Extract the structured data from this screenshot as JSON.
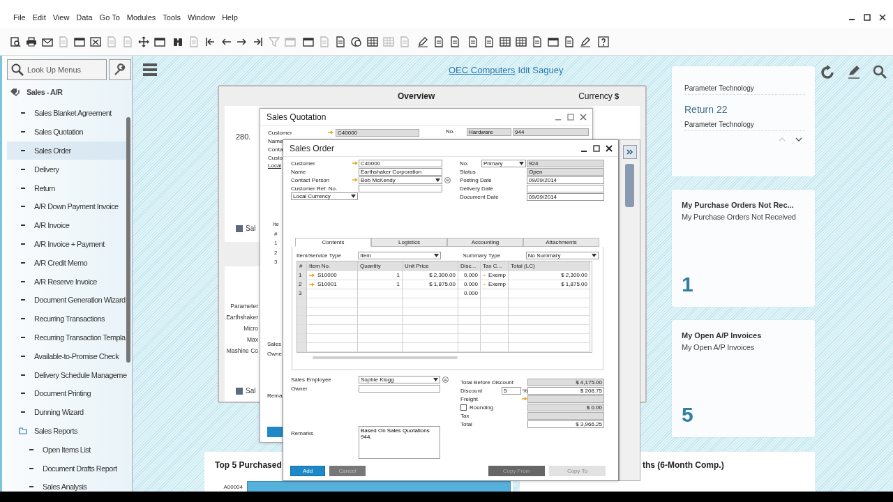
{
  "menu_bar": {
    "items": [
      "File",
      "Edit",
      "View",
      "Data",
      "Go To",
      "Modules",
      "Tools",
      "Window",
      "Help"
    ]
  },
  "toolbar": {
    "groups": [
      [
        {
          "kind": "find",
          "disabled": false
        },
        {
          "kind": "print",
          "disabled": false
        },
        {
          "kind": "email",
          "disabled": false
        },
        {
          "kind": "doc",
          "disabled": true
        },
        {
          "kind": "window",
          "disabled": false
        },
        {
          "kind": "excel",
          "disabled": false
        },
        {
          "kind": "doc",
          "disabled": true
        },
        {
          "kind": "doc",
          "disabled": true
        },
        {
          "kind": "move",
          "disabled": false
        },
        {
          "kind": "window",
          "disabled": false
        }
      ],
      [
        {
          "kind": "binoculars",
          "disabled": false
        },
        {
          "kind": "doc",
          "disabled": true
        },
        {
          "kind": "first",
          "disabled": false
        },
        {
          "kind": "prev",
          "disabled": false
        },
        {
          "kind": "next",
          "disabled": false
        },
        {
          "kind": "last",
          "disabled": false
        },
        {
          "kind": "filter",
          "disabled": true
        },
        {
          "kind": "window",
          "disabled": true
        }
      ],
      [
        {
          "kind": "window",
          "disabled": false
        },
        {
          "kind": "doc",
          "disabled": true
        },
        {
          "kind": "doc",
          "disabled": false
        },
        {
          "kind": "coin",
          "disabled": false
        },
        {
          "kind": "table",
          "disabled": false
        },
        {
          "kind": "table",
          "disabled": true
        },
        {
          "kind": "doc",
          "disabled": true
        }
      ],
      [
        {
          "kind": "edit",
          "disabled": false
        },
        {
          "kind": "doc",
          "disabled": false
        },
        {
          "kind": "doc",
          "disabled": false
        }
      ],
      [
        {
          "kind": "doc",
          "disabled": false
        },
        {
          "kind": "doc",
          "disabled": false
        },
        {
          "kind": "table",
          "disabled": false
        },
        {
          "kind": "table",
          "disabled": false
        },
        {
          "kind": "doc",
          "disabled": false
        },
        {
          "kind": "window",
          "disabled": false
        },
        {
          "kind": "doc",
          "disabled": false
        },
        {
          "kind": "edit",
          "disabled": false
        }
      ],
      [
        {
          "kind": "help",
          "disabled": false
        }
      ]
    ]
  },
  "sidebar": {
    "search": {
      "placeholder": "Look Up Menus"
    },
    "module": "Sales - A/R",
    "items": [
      {
        "label": "Sales Blanket Agreement",
        "kind": "item",
        "selected": false
      },
      {
        "label": "Sales Quotation",
        "kind": "item",
        "selected": false
      },
      {
        "label": "Sales Order",
        "kind": "item",
        "selected": true
      },
      {
        "label": "Delivery",
        "kind": "item",
        "selected": false
      },
      {
        "label": "Return",
        "kind": "item",
        "selected": false
      },
      {
        "label": "A/R Down Payment Invoice",
        "kind": "item",
        "selected": false
      },
      {
        "label": "A/R Invoice",
        "kind": "item",
        "selected": false
      },
      {
        "label": "A/R Invoice + Payment",
        "kind": "item",
        "selected": false
      },
      {
        "label": "A/R Credit Memo",
        "kind": "item",
        "selected": false
      },
      {
        "label": "A/R Reserve Invoice",
        "kind": "item",
        "selected": false
      },
      {
        "label": "Document Generation Wizard",
        "kind": "item",
        "selected": false
      },
      {
        "label": "Recurring Transactions",
        "kind": "item",
        "selected": false
      },
      {
        "label": "Recurring Transaction Templa",
        "kind": "item",
        "selected": false
      },
      {
        "label": "Available-to-Promise Check",
        "kind": "item",
        "selected": false
      },
      {
        "label": "Delivery Schedule Manageme",
        "kind": "item",
        "selected": false
      },
      {
        "label": "Document Printing",
        "kind": "item",
        "selected": false
      },
      {
        "label": "Dunning Wizard",
        "kind": "item",
        "selected": false
      },
      {
        "label": "Sales Reports",
        "kind": "folder",
        "selected": false,
        "children": [
          {
            "label": "Open Items List",
            "kind": "item",
            "selected": false
          },
          {
            "label": "Document Drafts Report",
            "kind": "item",
            "selected": false
          },
          {
            "label": "Sales Analysis",
            "kind": "item",
            "selected": false
          }
        ]
      }
    ]
  },
  "cockpit_header": {
    "company": "OEC Computers",
    "user": "Idit Saguey"
  },
  "overview_widget": {
    "title": "Overview",
    "currency_label": "Currency",
    "currency_symbol": "$",
    "value": "280.",
    "legend_1": "Sal",
    "labels": [
      "Parameter",
      "Earthshaker",
      "Micro",
      "Max",
      "Mashine Co"
    ],
    "legend_2": "Sal"
  },
  "sales_quotation": {
    "title": "Sales Quotation",
    "left_labels": [
      "Customer",
      "Name",
      "Conta",
      "Custo"
    ],
    "customer": "C40000",
    "currency": "Local",
    "number_label": "No.",
    "series": "Hardware",
    "number": "944",
    "grid_labels": [
      "Ite",
      "#",
      "1",
      "2",
      "3"
    ],
    "lower_labels": [
      "Sales",
      "Owne"
    ],
    "remarks_label": "Rema"
  },
  "sales_order": {
    "title": "Sales Order",
    "left_fields": [
      {
        "label": "Customer",
        "value": "C40000",
        "kind": "text",
        "linked": true,
        "details": false
      },
      {
        "label": "Name",
        "value": "Earthshaker Corporation",
        "kind": "text",
        "linked": false,
        "details": false
      },
      {
        "label": "Contact Person",
        "value": "Bob McKendy",
        "kind": "dropdown",
        "linked": true,
        "details": true
      },
      {
        "label": "Customer Ref. No.",
        "kind": "text",
        "linked": false,
        "details": false
      }
    ],
    "currency": "Local Currency",
    "right_fields": [
      {
        "label": "No.",
        "series": "Primary",
        "value": "924",
        "readonly": true
      },
      {
        "label": "Status",
        "value": "Open",
        "readonly": true
      },
      {
        "label": "Posting Date",
        "value": "09/09/2014",
        "readonly": false
      },
      {
        "label": "Delivery Date",
        "readonly": false
      },
      {
        "label": "Document Date",
        "value": "09/09/2014",
        "readonly": false
      }
    ],
    "tabs": [
      {
        "label": "Contents",
        "selected": true
      },
      {
        "label": "Logistics",
        "selected": false
      },
      {
        "label": "Accounting",
        "selected": false
      },
      {
        "label": "Attachments",
        "selected": false
      }
    ],
    "item_type_label": "Item/Service Type",
    "item_type": "Item",
    "summary_type_label": "Summary Type",
    "summary_type": "No Summary",
    "table": {
      "columns": [
        "#",
        "Item No.",
        "Quantity",
        "Unit Price",
        "Disc...",
        "Tax C...",
        "Total (LC)"
      ],
      "rows": [
        {
          "num": "1",
          "item": "S10000",
          "quantity": "1",
          "unit_price": "$ 2,300.00",
          "discount": "0.000",
          "tax_code": "Exemp",
          "total": "$ 2,300.00"
        },
        {
          "num": "2",
          "item": "S10001",
          "quantity": "1",
          "unit_price": "$ 1,875.00",
          "discount": "0.000",
          "tax_code": "Exemp",
          "total": "$ 1,875.00"
        },
        {
          "num": "3",
          "discount": "0.000"
        }
      ]
    },
    "sales_employee": {
      "label": "Sales Employee",
      "value": "Sophie Klogg"
    },
    "owner": {
      "label": "Owner"
    },
    "remarks": {
      "label": "Remarks",
      "value": "Based On Sales Quotations 944."
    },
    "totals": [
      {
        "label": "Total Before Discount",
        "value": "$ 4,175.00",
        "kind": "plain",
        "readonly": true
      },
      {
        "label": "Discount",
        "percent": "5",
        "percent_sign": "%",
        "value": "$ 208.75",
        "kind": "percent",
        "readonly": false
      },
      {
        "label": "Freight",
        "kind": "linked",
        "readonly": true
      },
      {
        "label": "Rounding",
        "value": "$ 0.00",
        "kind": "checkbox",
        "checked": false,
        "readonly": true
      },
      {
        "label": "Tax",
        "kind": "plain",
        "readonly": true
      },
      {
        "label": "Total",
        "value": "$ 3,966.25",
        "kind": "plain",
        "readonly": false
      }
    ],
    "buttons": [
      {
        "label": "Add",
        "kind": "primary",
        "disabled": false
      },
      {
        "label": "Cancel",
        "kind": "secondary",
        "disabled": false
      },
      {
        "label": "Copy From",
        "kind": "dark",
        "disabled": false
      },
      {
        "label": "Copy To",
        "kind": "dark",
        "disabled": true
      }
    ]
  },
  "list_card": {
    "entries": [
      {
        "subtitle": "Parameter Technology"
      },
      {
        "title": "Return 22",
        "subtitle": "Parameter Technology"
      }
    ]
  },
  "kpi_cards": [
    {
      "title": "My Purchase Orders Not Rec...",
      "subtitle": "My Purchase Orders Not Received",
      "value": "1"
    },
    {
      "title": "My Open A/P Invoices",
      "subtitle": "My Open A/P Invoices",
      "value": "5"
    }
  ],
  "bottom_cards": [
    {
      "title": "Top 5 Purchased",
      "bar_label": "A00004"
    },
    {
      "title": "ths (6-Month Comp.)"
    }
  ]
}
